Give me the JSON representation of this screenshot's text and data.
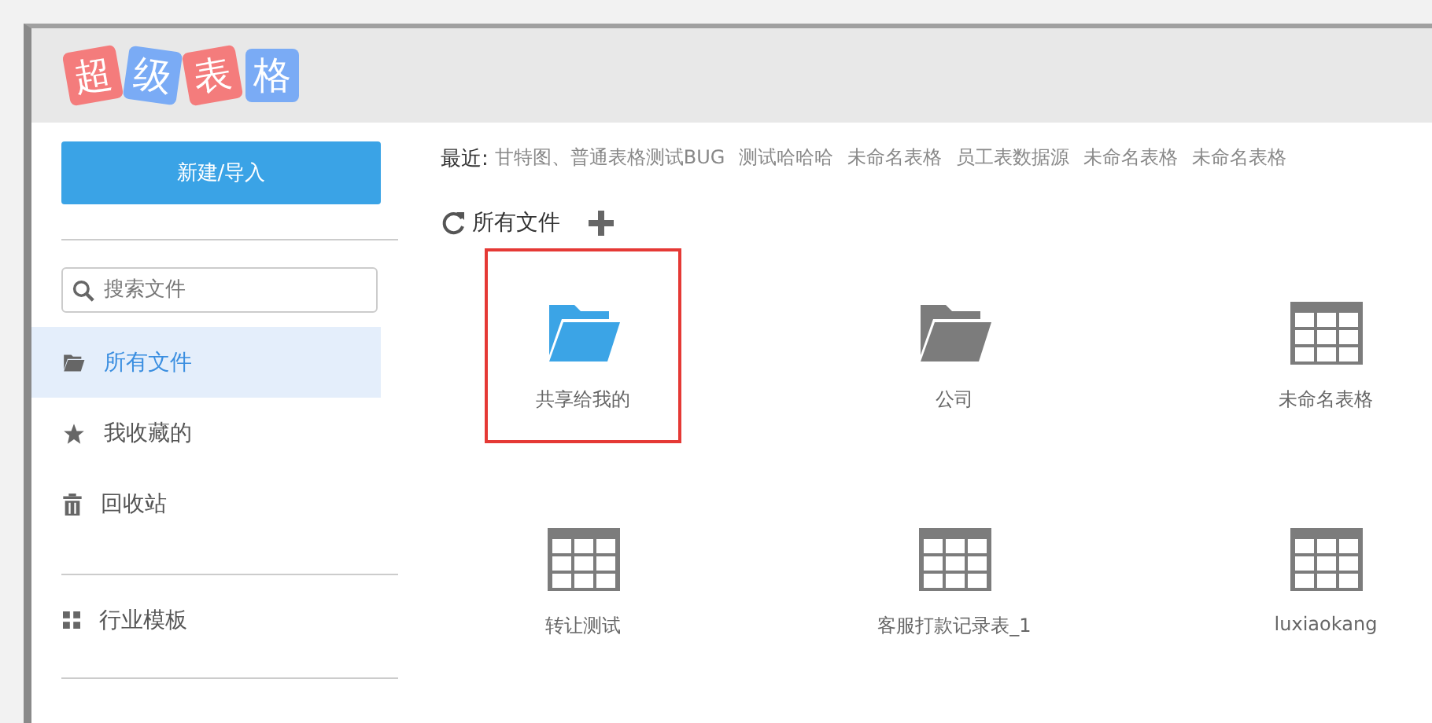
{
  "logo": [
    {
      "char": "超",
      "color": "#f47c7c"
    },
    {
      "char": "级",
      "color": "#7aabf5"
    },
    {
      "char": "表",
      "color": "#f47c7c"
    },
    {
      "char": "格",
      "color": "#7aabf5"
    }
  ],
  "sidebar": {
    "new_button": "新建/导入",
    "search": {
      "placeholder": "搜索文件"
    },
    "items": [
      {
        "kind": "folder",
        "label": "所有文件",
        "selected": true
      },
      {
        "kind": "star",
        "label": "我收藏的",
        "selected": false
      },
      {
        "kind": "trash",
        "label": "回收站",
        "selected": false
      }
    ],
    "templates": {
      "kind": "grid",
      "label": "行业模板",
      "selected": false
    }
  },
  "recent": {
    "label": "最近:",
    "items": [
      "甘特图、普通表格测试BUG",
      "测试哈哈哈",
      "未命名表格",
      "员工表数据源",
      "未命名表格",
      "未命名表格"
    ]
  },
  "toolbar": {
    "title": "所有文件"
  },
  "files": [
    {
      "kind": "folder",
      "name": "共享给我的",
      "color": "#3ba4e6",
      "highlighted": true
    },
    {
      "kind": "folder",
      "name": "公司",
      "color": "#7c7c7c",
      "highlighted": false
    },
    {
      "kind": "sheet",
      "name": "未命名表格",
      "highlighted": false
    },
    {
      "kind": "sheet",
      "name": "转让测试",
      "highlighted": false
    },
    {
      "kind": "sheet",
      "name": "客服打款记录表_1",
      "highlighted": false
    },
    {
      "kind": "sheet",
      "name": "luxiaokang",
      "highlighted": false
    }
  ]
}
